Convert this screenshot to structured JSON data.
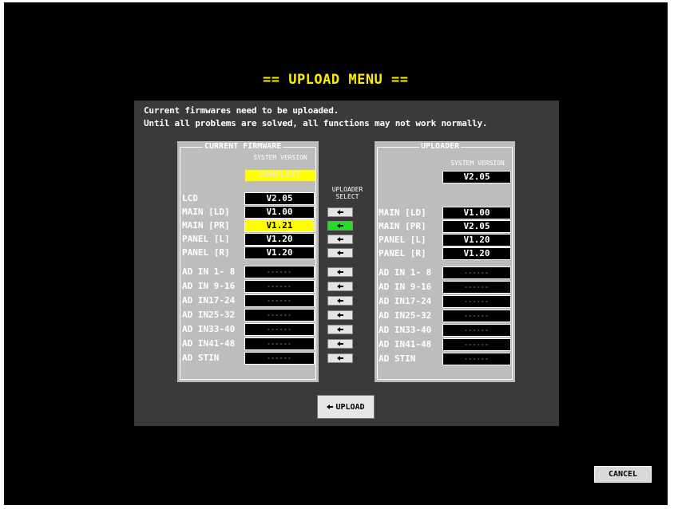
{
  "title": "== UPLOAD MENU ==",
  "messages": [
    "Current firmwares need to be uploaded.",
    "Until all problems are solved, all functions may not work normally."
  ],
  "current_firmware": {
    "title": "CURRENT FIRMWARE",
    "system_version_label": "SYSTEM VERSION",
    "system_version_value": "CONFLICT",
    "rows": [
      {
        "label": "LCD",
        "value": "V2.05",
        "highlight": false
      },
      {
        "label": "MAIN [LD]",
        "value": "V1.00",
        "highlight": false
      },
      {
        "label": "MAIN [PR]",
        "value": "V1.21",
        "highlight": true
      },
      {
        "label": "PANEL [L]",
        "value": "V1.20",
        "highlight": false
      },
      {
        "label": "PANEL [R]",
        "value": "V1.20",
        "highlight": false
      },
      {
        "label": "AD IN 1- 8",
        "value": "------",
        "highlight": false
      },
      {
        "label": "AD IN 9-16",
        "value": "------",
        "highlight": false
      },
      {
        "label": "AD IN17-24",
        "value": "------",
        "highlight": false
      },
      {
        "label": "AD IN25-32",
        "value": "------",
        "highlight": false
      },
      {
        "label": "AD IN33-40",
        "value": "------",
        "highlight": false
      },
      {
        "label": "AD IN41-48",
        "value": "------",
        "highlight": false
      },
      {
        "label": "AD STIN",
        "value": "------",
        "highlight": false
      }
    ]
  },
  "uploader_select": {
    "label_line1": "UPLOADER",
    "label_line2": "SELECT",
    "icon": "left-arrow-icon",
    "active_color": "#22dd22",
    "selected_index": 1
  },
  "uploader": {
    "title": "UPLOADER",
    "system_version_label": "SYSTEM VERSION",
    "system_version_value": "V2.05",
    "rows": [
      {
        "label": "MAIN [LD]",
        "value": "V1.00"
      },
      {
        "label": "MAIN [PR]",
        "value": "V2.05"
      },
      {
        "label": "PANEL [L]",
        "value": "V1.20"
      },
      {
        "label": "PANEL [R]",
        "value": "V1.20"
      },
      {
        "label": "AD IN 1- 8",
        "value": "------"
      },
      {
        "label": "AD IN 9-16",
        "value": "------"
      },
      {
        "label": "AD IN17-24",
        "value": "------"
      },
      {
        "label": "AD IN25-32",
        "value": "------"
      },
      {
        "label": "AD IN33-40",
        "value": "------"
      },
      {
        "label": "AD IN41-48",
        "value": "------"
      },
      {
        "label": "AD STIN",
        "value": "------"
      }
    ]
  },
  "upload_button": {
    "label": "UPLOAD",
    "icon": "left-arrow-icon"
  },
  "cancel_button": {
    "label": "CANCEL"
  },
  "colors": {
    "title": "#ffee00",
    "conflict": "#ffff00",
    "active_select": "#22dd22",
    "panel": "#3a3a3a"
  }
}
